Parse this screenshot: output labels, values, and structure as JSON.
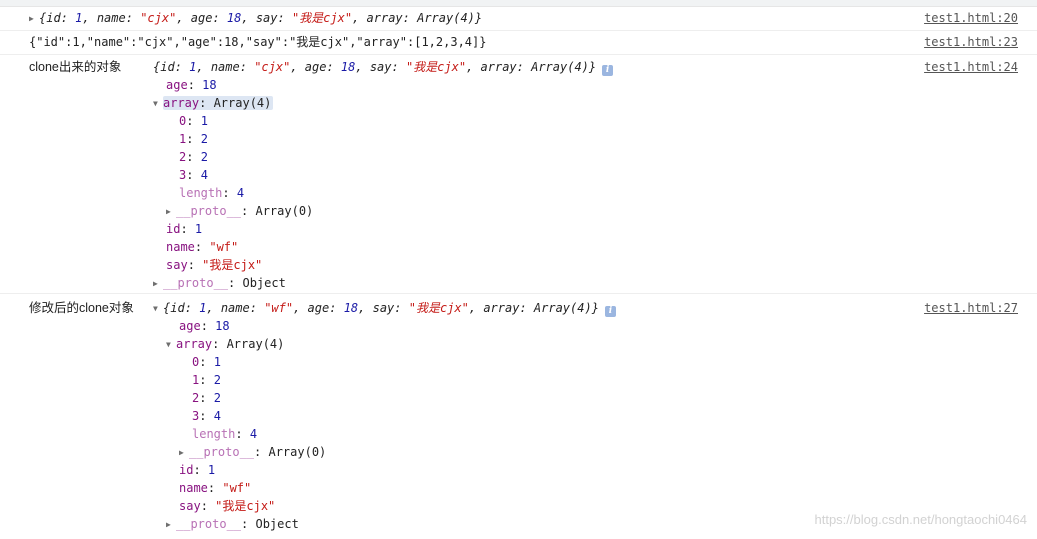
{
  "messages": [
    {
      "source": "test1.html:20",
      "summary": {
        "id": "1",
        "name": "\"cjx\"",
        "age": "18",
        "say": "\"我是cjx\"",
        "array": "Array(4)"
      }
    },
    {
      "source": "test1.html:23",
      "text": "{\"id\":1,\"name\":\"cjx\",\"age\":18,\"say\":\"我是cjx\",\"array\":[1,2,3,4]}"
    },
    {
      "source": "test1.html:24",
      "label": "clone出来的对象",
      "summary": {
        "id": "1",
        "name": "\"cjx\"",
        "age": "18",
        "say": "\"我是cjx\"",
        "array": "Array(4)"
      },
      "age": "18",
      "array_summary": "Array(4)",
      "items": [
        "1",
        "2",
        "2",
        "4"
      ],
      "length": "4",
      "proto_array": "Array(0)",
      "id": "1",
      "name": "\"wf\"",
      "say": "\"我是cjx\"",
      "proto": "Object"
    },
    {
      "source": "test1.html:27",
      "label": "修改后的clone对象",
      "summary": {
        "id": "1",
        "name": "\"wf\"",
        "age": "18",
        "say": "\"我是cjx\"",
        "array": "Array(4)"
      },
      "age": "18",
      "array_summary": "Array(4)",
      "items": [
        "1",
        "2",
        "2",
        "4"
      ],
      "length": "4",
      "proto_array": "Array(0)",
      "id": "1",
      "name": "\"wf\"",
      "say": "\"我是cjx\"",
      "proto": "Object"
    }
  ],
  "keys": {
    "id": "id",
    "name": "name",
    "age": "age",
    "say": "say",
    "array": "array",
    "length": "length",
    "proto": "__proto__",
    "i0": "0",
    "i1": "1",
    "i2": "2",
    "i3": "3"
  },
  "watermark": "https://blog.csdn.net/hongtaochi0464",
  "icons": {
    "collapsed": "triangle-right-icon",
    "expanded": "triangle-down-icon",
    "info": "info-icon"
  }
}
